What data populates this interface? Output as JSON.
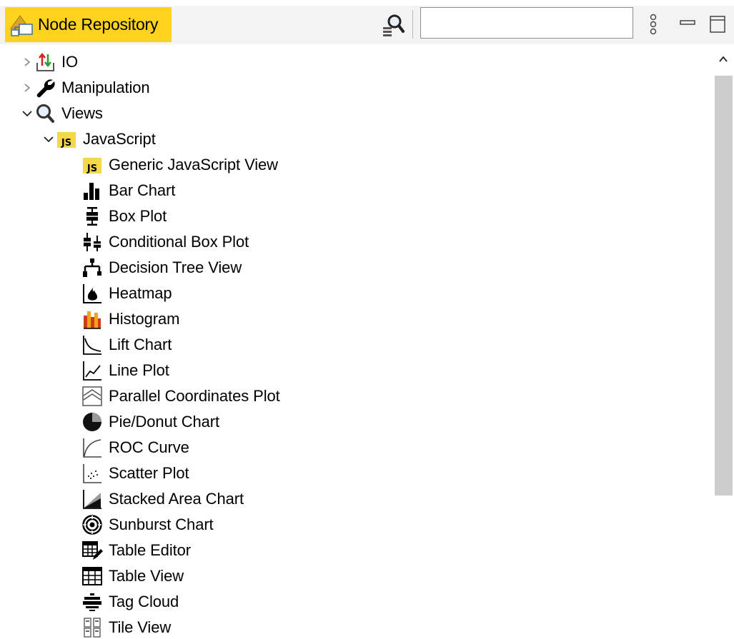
{
  "panel": {
    "title": "Node Repository",
    "search_value": "",
    "icons": {
      "tab": "node-repository-icon",
      "find": "search-node-icon",
      "menu": "view-menu-icon",
      "minimize": "minimize-icon",
      "maximize": "maximize-icon"
    }
  },
  "tree": {
    "io": "IO",
    "manipulation": "Manipulation",
    "views": "Views",
    "javascript": "JavaScript",
    "items": [
      "Generic JavaScript View",
      "Bar Chart",
      "Box Plot",
      "Conditional Box Plot",
      "Decision Tree View",
      "Heatmap",
      "Histogram",
      "Lift Chart",
      "Line Plot",
      "Parallel Coordinates Plot",
      "Pie/Donut Chart",
      "ROC Curve",
      "Scatter Plot",
      "Stacked Area Chart",
      "Sunburst Chart",
      "Table Editor",
      "Table View",
      "Tag Cloud",
      "Tile View"
    ]
  },
  "colors": {
    "accent": "#ffd21e",
    "toolbar_bg": "#f3f3f3",
    "scroll_thumb": "#cdcdcd"
  }
}
